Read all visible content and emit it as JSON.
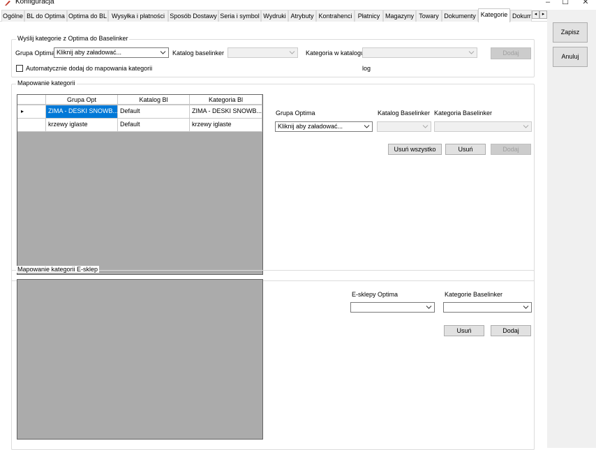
{
  "window": {
    "title": "Konfiguracja",
    "minimize": "–",
    "maximize": "☐",
    "close": "✕"
  },
  "tabs": [
    {
      "label": "Ogólne"
    },
    {
      "label": "BL do Optima"
    },
    {
      "label": "Optima do BL"
    },
    {
      "label": "Wysyłka i płatności"
    },
    {
      "label": "Sposób Dostawy"
    },
    {
      "label": "Seria i symbol"
    },
    {
      "label": "Wydruki"
    },
    {
      "label": "Atrybuty"
    },
    {
      "label": "Kontrahenci"
    },
    {
      "label": "Płatnicy"
    },
    {
      "label": "Magazyny"
    },
    {
      "label": "Towary"
    },
    {
      "label": "Dokumenty"
    },
    {
      "label": "Kategorie"
    },
    {
      "label": "Dokum"
    }
  ],
  "active_tab": "Kategorie",
  "tab_scroll": {
    "left": "◂",
    "right": "▸"
  },
  "right_panel": {
    "save": "Zapisz",
    "cancel": "Anuluj"
  },
  "send_group": {
    "title": "Wyślij kategorie z Optima do Baselinker",
    "grupa_label": "Grupa Optima",
    "grupa_value": "Kliknij aby załadować...",
    "katalog_label": "Katalog baselinker",
    "katalog_value": "",
    "kategoria_label": "Kategoria w katalogu",
    "kategoria_value": "",
    "add_button": "Dodaj",
    "auto_checkbox_label": "Automatycznie dodaj do mapowania kategorii",
    "log_label": "log"
  },
  "mapping_group": {
    "title": "Mapowanie kategorii",
    "columns": [
      "Grupa Opt",
      "Katalog Bl",
      "Kategoria Bl"
    ],
    "rows": [
      {
        "indicator": "▸",
        "grupa": "ZIMA - DESKI SNOWB...",
        "katalog": "Default",
        "kategoria": "ZIMA - DESKI SNOWB..."
      },
      {
        "indicator": "",
        "grupa": "krzewy iglaste",
        "katalog": "Default",
        "kategoria": "krzewy iglaste"
      }
    ],
    "grupa_label": "Grupa Optima",
    "grupa_value": "Kliknij aby załadować...",
    "katalog_label": "Katalog Baselinker",
    "katalog_value": "",
    "kategoria_label": "Kategoria Baselinker",
    "kategoria_value": "",
    "remove_all_button": "Usuń wszystko",
    "remove_button": "Usuń",
    "add_button": "Dodaj"
  },
  "eshop_group": {
    "title": "Mapowanie kategorii E-sklep",
    "esklepy_label": "E-sklepy Optima",
    "esklepy_value": "",
    "kategorie_label": "Kategorie Baselinker",
    "kategorie_value": "",
    "remove_button": "Usuń",
    "add_button": "Dodaj"
  }
}
